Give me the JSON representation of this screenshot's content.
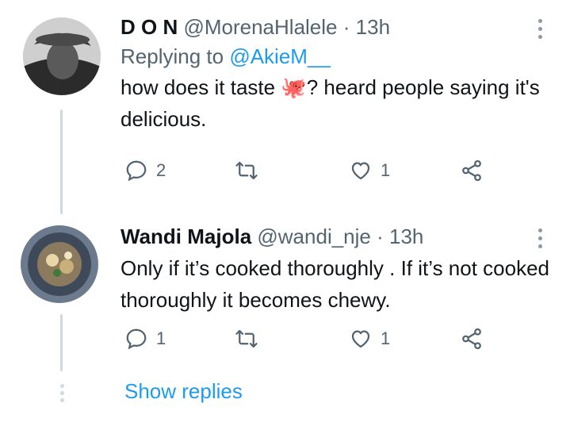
{
  "tweets": [
    {
      "display_name": "D O N",
      "handle": "@MorenaHlalele",
      "separator": "·",
      "time": "13h",
      "replying_prefix": "Replying to",
      "replying_to": "@AkieM__",
      "text_part1": "how does it taste ",
      "emoji": "🐙",
      "text_part2": "? heard people saying it's delicious.",
      "reply_count": "2",
      "retweet_count": "",
      "like_count": "1"
    },
    {
      "display_name": "Wandi Majola",
      "handle": "@wandi_nje",
      "separator": "·",
      "time": "13h",
      "text": "Only if it’s cooked thoroughly . If it’s not cooked thoroughly it becomes chewy.",
      "reply_count": "1",
      "retweet_count": "",
      "like_count": "1"
    }
  ],
  "show_replies_label": "Show replies",
  "colors": {
    "accent": "#1d9bf0",
    "muted": "#536471",
    "thread_line": "#cfd9de"
  },
  "icons": [
    "more-options-icon",
    "reply-icon",
    "retweet-icon",
    "like-icon",
    "share-icon"
  ]
}
